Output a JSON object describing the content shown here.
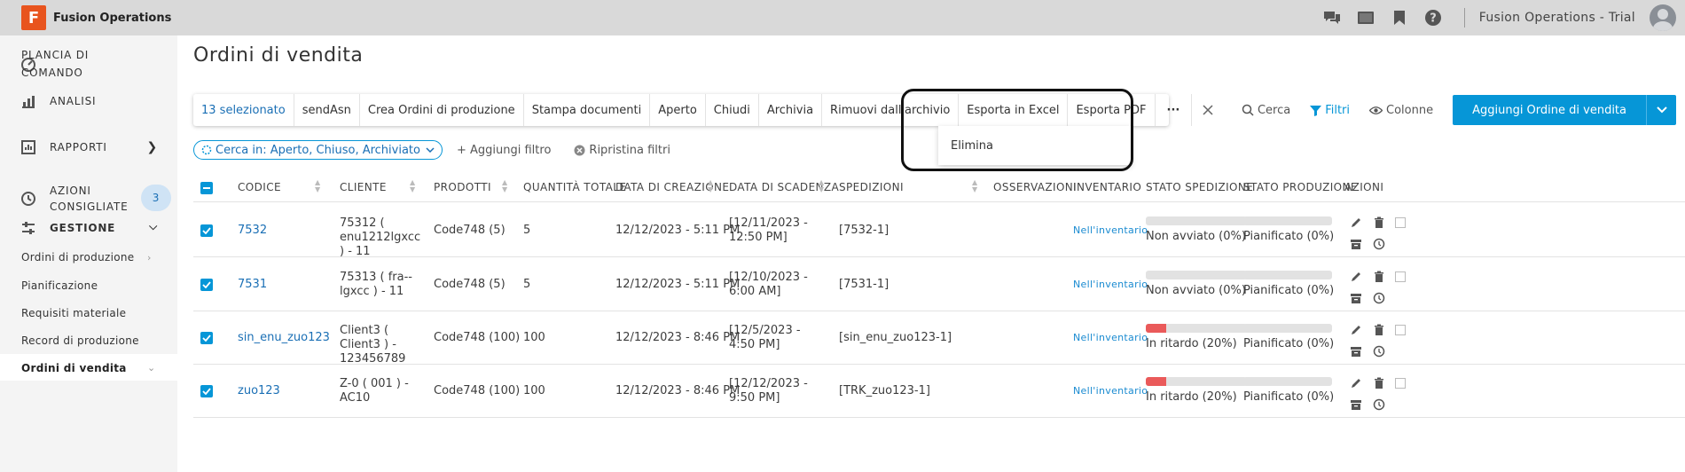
{
  "app": {
    "logo_letter": "F",
    "title": "Fusion Operations",
    "account": "Fusion Operations - Trial"
  },
  "top_icons": [
    "chat-icon",
    "screen-icon",
    "bookmark-icon",
    "help-icon"
  ],
  "sidebar": {
    "dashboard": "PLANCIA DI COMANDO",
    "analytics": "ANALISI",
    "reports": "RAPPORTI",
    "suggested_actions": "AZIONI CONSIGLIATE",
    "suggested_count": "3",
    "management": "GESTIONE",
    "sub_items": [
      "Ordini di produzione",
      "Pianificazione",
      "Requisiti materiale",
      "Record di produzione",
      "Ordini di vendita"
    ]
  },
  "page": {
    "title": "Ordini di vendita"
  },
  "toolbar": {
    "selected": "13 selezionato",
    "actions": [
      "sendAsn",
      "Crea Ordini di produzione",
      "Stampa documenti",
      "Aperto",
      "Chiudi",
      "Archivia",
      "Rimuovi dall'archivio",
      "Esporta in Excel",
      "Esporta PDF"
    ],
    "more": "···",
    "dropdown_item": "Elimina"
  },
  "tools": {
    "search": "Cerca",
    "filters": "Filtri",
    "columns": "Colonne",
    "add_button": "Aggiungi Ordine di vendita"
  },
  "filters": {
    "chip": "Cerca in: Aperto, Chiuso, Archiviato",
    "add_filter": "+ Aggiungi filtro",
    "reset": "Ripristina filtri"
  },
  "columns": [
    "CODICE",
    "CLIENTE",
    "PRODOTTI",
    "QUANTITÀ TOTALE",
    "DATA DI CREAZIONE",
    "DATA DI SCADENZA",
    "SPEDIZIONI",
    "OSSERVAZIONI",
    "INVENTARIO",
    "STATO SPEDIZIONE",
    "STATO PRODUZIONE",
    "AZIONI"
  ],
  "rows": [
    {
      "code": "7532",
      "client": "75312 ( enu1212lgxcc ) - 11",
      "products": "Code748 (5)",
      "qty": "5",
      "created": "12/12/2023 - 5:11 PM",
      "due": "[12/11/2023 - 12:50 PM]",
      "shipments": "[7532-1]",
      "inventory": "Nell'inventario",
      "ship_status": "Non avviato (0%)",
      "ship_pct": 0,
      "prod_status": "Pianificato (0%)",
      "prod_pct": 0
    },
    {
      "code": "7531",
      "client": "75313 ( fra--lgxcc ) - 11",
      "products": "Code748 (5)",
      "qty": "5",
      "created": "12/12/2023 - 5:11 PM",
      "due": "[12/10/2023 - 6:00 AM]",
      "shipments": "[7531-1]",
      "inventory": "Nell'inventario",
      "ship_status": "Non avviato (0%)",
      "ship_pct": 0,
      "prod_status": "Pianificato (0%)",
      "prod_pct": 0
    },
    {
      "code": "sin_enu_zuo123",
      "client": "Client3 ( Client3 ) - 123456789",
      "products": "Code748 (100)",
      "qty": "100",
      "created": "12/12/2023 - 8:46 PM",
      "due": "[12/5/2023 - 4:50 PM]",
      "shipments": "[sin_enu_zuo123-1]",
      "inventory": "Nell'inventario",
      "ship_status": "In ritardo (20%)",
      "ship_pct": 20,
      "prod_status": "Pianificato (0%)",
      "prod_pct": 0
    },
    {
      "code": "zuo123",
      "client": "Z-0 ( 001 ) - AC10",
      "products": "Code748 (100)",
      "qty": "100",
      "created": "12/12/2023 - 8:46 PM",
      "due": "[12/12/2023 - 9:50 PM]",
      "shipments": "[TRK_zuo123-1]",
      "inventory": "Nell'inventario",
      "ship_status": "In ritardo (20%)",
      "ship_pct": 20,
      "prod_status": "Pianificato (0%)",
      "prod_pct": 0
    }
  ],
  "colors": {
    "accent": "#0696d7",
    "link": "#1a6fb5",
    "danger": "#ea5a5a",
    "logo": "#e8541e"
  }
}
